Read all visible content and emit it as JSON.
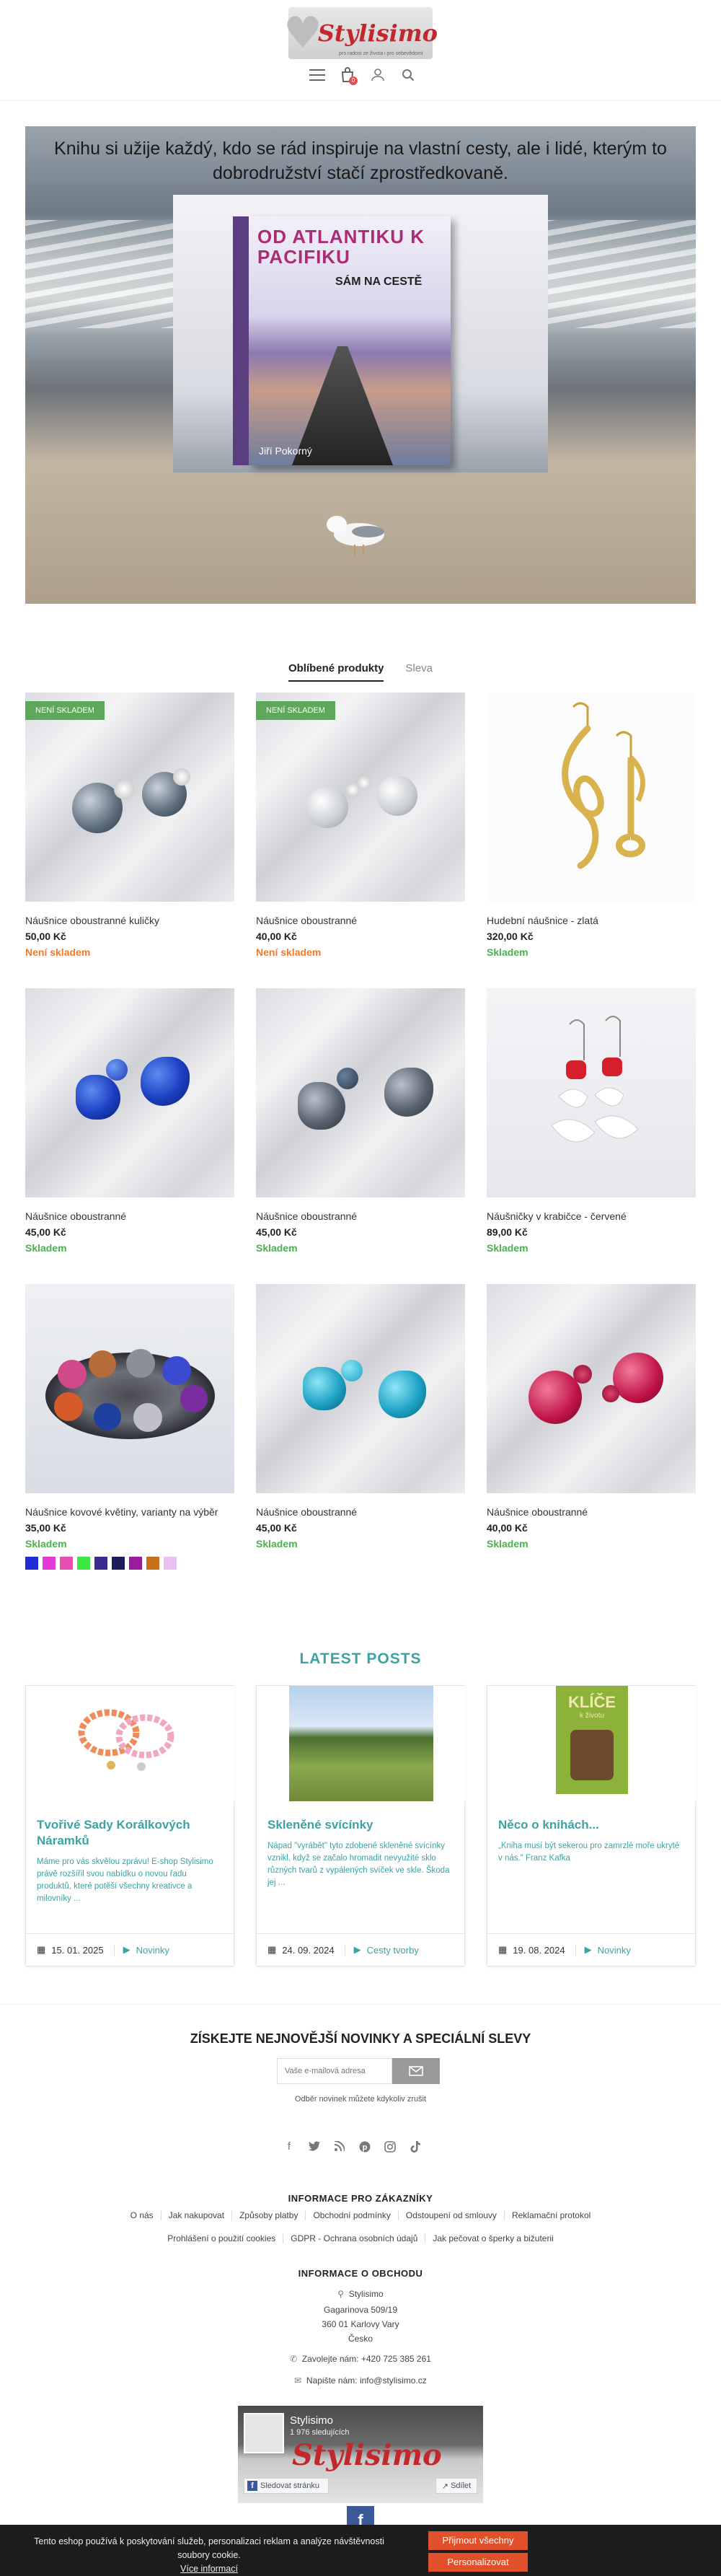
{
  "header": {
    "logo_text": "Stylisimo",
    "logo_tagline": "pro radost ze života i pro sebevědomí",
    "cart_count": "0",
    "icons": [
      "menu-icon",
      "cart-icon",
      "user-icon",
      "search-icon"
    ]
  },
  "hero": {
    "text": "Knihu si užije každý, kdo se rád inspiruje na vlastní cesty, ale i lidé, kterým to dobrodružství stačí zprostředkovaně.",
    "book_title": "OD ATLANTIKU K PACIFIKU",
    "book_subtitle": "SÁM NA CESTĚ",
    "book_author": "Jiří Pokorný"
  },
  "tabs": [
    {
      "label": "Oblíbené produkty",
      "active": true
    },
    {
      "label": "Sleva",
      "active": false
    }
  ],
  "products": [
    {
      "name": "Náušnice oboustranné kuličky",
      "price": "50,00 Kč",
      "availability": "Není skladem",
      "in_stock": false,
      "badge": "NENÍ SKLADEM"
    },
    {
      "name": "Náušnice oboustranné",
      "price": "40,00 Kč",
      "availability": "Není skladem",
      "in_stock": false,
      "badge": "NENÍ SKLADEM"
    },
    {
      "name": "Hudební náušnice - zlatá",
      "price": "320,00 Kč",
      "availability": "Skladem",
      "in_stock": true,
      "badge": ""
    },
    {
      "name": "Náušnice oboustranné",
      "price": "45,00 Kč",
      "availability": "Skladem",
      "in_stock": true,
      "badge": ""
    },
    {
      "name": "Náušnice oboustranné",
      "price": "45,00 Kč",
      "availability": "Skladem",
      "in_stock": true,
      "badge": ""
    },
    {
      "name": "Náušničky v krabičce - červené",
      "price": "89,00 Kč",
      "availability": "Skladem",
      "in_stock": true,
      "badge": ""
    },
    {
      "name": "Náušnice kovové květiny, varianty na výběr",
      "price": "35,00 Kč",
      "availability": "Skladem",
      "in_stock": true,
      "badge": ""
    },
    {
      "name": "Náušnice oboustranné",
      "price": "45,00 Kč",
      "availability": "Skladem",
      "in_stock": true,
      "badge": ""
    },
    {
      "name": "Náušnice oboustranné",
      "price": "40,00 Kč",
      "availability": "Skladem",
      "in_stock": true,
      "badge": ""
    }
  ],
  "variant_swatches": [
    "#1f2bd6",
    "#e23ad6",
    "#e84fb0",
    "#3fe63f",
    "#3b2d8f",
    "#1a1f5a",
    "#9b1c9b",
    "#c8701e",
    "#e7c2f0"
  ],
  "latest_posts": {
    "heading": "LATEST POSTS",
    "posts": [
      {
        "title": "Tvořivé Sady Korálkových Náramků",
        "excerpt": "Máme pro vás skvělou zprávu! E-shop Stylisimo právě rozšířil svou nabídku o novou řadu produktů, které potěší všechny kreativce a milovníky ...",
        "date": "15. 01. 2025",
        "category": "Novinky"
      },
      {
        "title": "Skleněné svícínky",
        "excerpt": "Nápad \"vyrábět\" tyto zdobené skleněné svícínky vznikl, když se začalo hromadit nevyužité sklo různých tvarů z vypálených svíček ve skle. Škoda jej ...",
        "date": "24. 09. 2024",
        "category": "Cesty tvorby"
      },
      {
        "title": "Něco o knihách...",
        "excerpt": "„Kniha musí být sekerou pro zamrzlé moře ukryté v nás.\" Franz Kafka",
        "date": "19. 08. 2024",
        "category": "Novinky",
        "book_cover_title": "KLÍČE",
        "book_cover_sub": "k životu"
      }
    ]
  },
  "newsletter": {
    "title": "ZÍSKEJTE NEJNOVĚJŠÍ NOVINKY A SPECIÁLNÍ SLEVY",
    "placeholder": "Vaše e-mailová adresa",
    "note": "Odběr novinek můžete kdykoliv zrušit"
  },
  "social_icons": [
    "facebook-icon",
    "twitter-icon",
    "rss-icon",
    "pinterest-icon",
    "instagram-icon",
    "tiktok-icon"
  ],
  "footer": {
    "customer_info_heading": "INFORMACE PRO ZÁKAZNÍKY",
    "links_row1": [
      "O nás",
      "Jak nakupovat",
      "Způsoby platby",
      "Obchodní podmínky",
      "Odstoupení od smlouvy",
      "Reklamační protokol"
    ],
    "links_row2": [
      "Prohlášení o použití cookies",
      "GDPR - Ochrana osobních údajů",
      "Jak pečovat o šperky a bižuterii"
    ],
    "store_info_heading": "INFORMACE O OBCHODU",
    "store_name": "Stylisimo",
    "street": "Gagarinova 509/19",
    "city": "360 01 Karlovy Vary",
    "country": "Česko",
    "phone_line": "Zavolejte nám: +420 725 385 261",
    "email_line": "Napište nám: info@stylisimo.cz",
    "facebook_widget": {
      "page_name": "Stylisimo",
      "followers": "1 976 sledujících",
      "follow_label": "Sledovat stránku",
      "share_label": "Sdílet"
    }
  },
  "cookie_bar": {
    "text": "Tento eshop používá k poskytování služeb, personalizaci reklam a analýze návštěvnosti soubory cookie.",
    "more_info": "Více informací",
    "accept_all": "Přijmout všechny cookies",
    "personalize": "Personalizovat"
  }
}
